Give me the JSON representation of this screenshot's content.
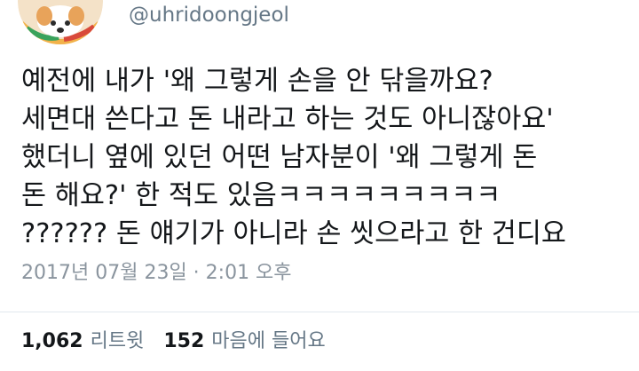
{
  "tweet": {
    "handle": "@uhridoongjeol",
    "avatar_icon": "dog-avatar-icon",
    "text_lines": [
      "예전에 내가 '왜 그렇게 손을 안 닦을까요?",
      "세면대 쓴다고 돈 내라고 하는 것도 아니잖아요'",
      "했더니 옆에 있던 어떤 남자분이 '왜 그렇게 돈",
      "돈 해요?' 한 적도 있음ㅋㅋㅋㅋㅋㅋㅋㅋㅋ",
      "?????? 돈 얘기가 아니라 손 씻으라고 한 건디요"
    ],
    "timestamp": "2017년 07월 23일 · 2:01 오후",
    "stats": {
      "retweets_count": "1,062",
      "retweets_label": "리트윗",
      "likes_count": "152",
      "likes_label": "마음에 들어요"
    }
  },
  "colors": {
    "text": "#14171a",
    "secondary": "#657786",
    "timestamp": "#8a949e",
    "divider": "#e1e8ed"
  }
}
